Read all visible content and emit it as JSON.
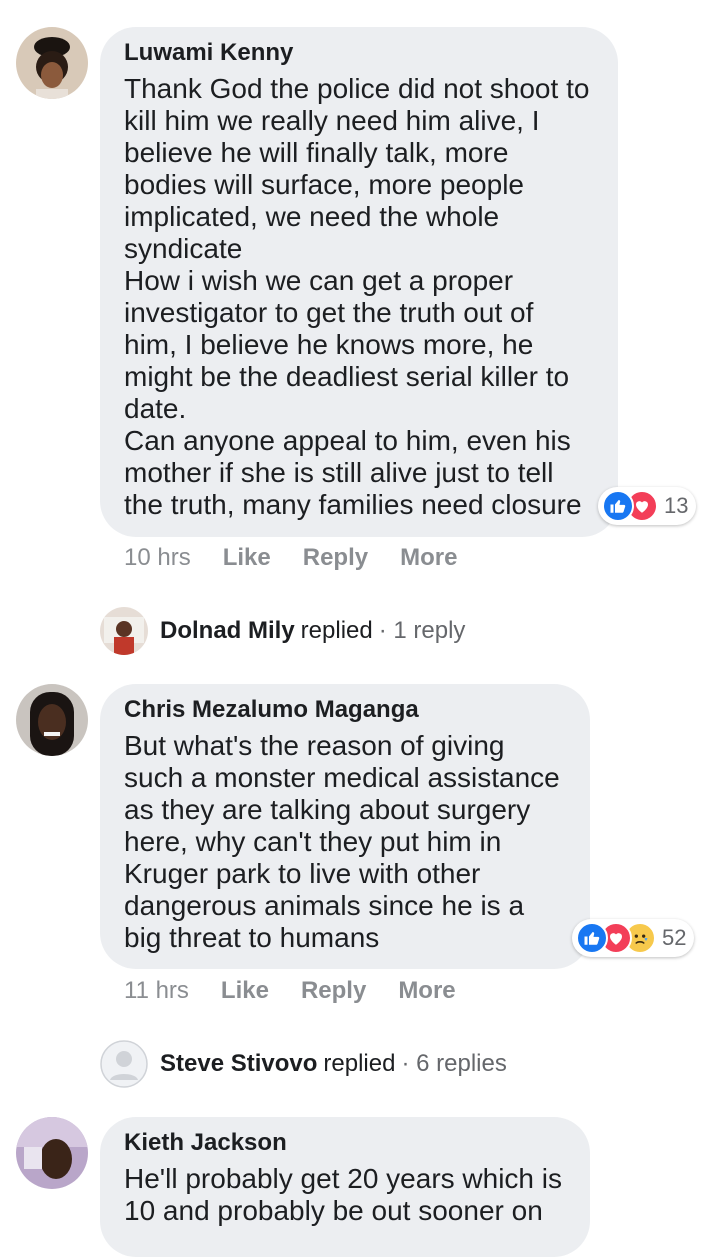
{
  "comments": [
    {
      "name": "Luwami Kenny",
      "text": "Thank God the police did not shoot to kill him we really need him alive, I believe he will finally talk, more bodies will surface, more people implicated, we need the whole syndicate\nHow i wish we can get a proper investigator to get the truth out of him, I believe he knows more, he might be the deadliest serial killer to date.\nCan anyone appeal to him, even his mother if she is still alive just to tell the truth, many families need closure",
      "reaction_icons": [
        "like",
        "love"
      ],
      "reaction_count": "13",
      "time": "10 hrs",
      "actions": {
        "like": "Like",
        "reply": "Reply",
        "more": "More"
      },
      "replied": {
        "name": "Dolnad Mily",
        "verb": "replied",
        "count": "· 1 reply"
      }
    },
    {
      "name": "Chris Mezalumo Maganga",
      "text": "But what's the reason of giving such a monster medical assistance as they are talking about surgery here, why can't they put him in Kruger park to live with other dangerous animals since he is a big threat to humans",
      "reaction_icons": [
        "like",
        "love",
        "sad"
      ],
      "reaction_count": "52",
      "time": "11 hrs",
      "actions": {
        "like": "Like",
        "reply": "Reply",
        "more": "More"
      },
      "replied": {
        "name": "Steve Stivovo",
        "verb": "replied",
        "count": "· 6 replies"
      }
    },
    {
      "name": "Kieth Jackson",
      "text": "He'll probably get 20 years which is 10 and probably be out sooner on"
    }
  ],
  "colors": {
    "bubble": "#eceef1",
    "like": "#1877f2",
    "love": "#f33e58",
    "sad": "#f7c94c",
    "meta": "#8a8d91"
  }
}
